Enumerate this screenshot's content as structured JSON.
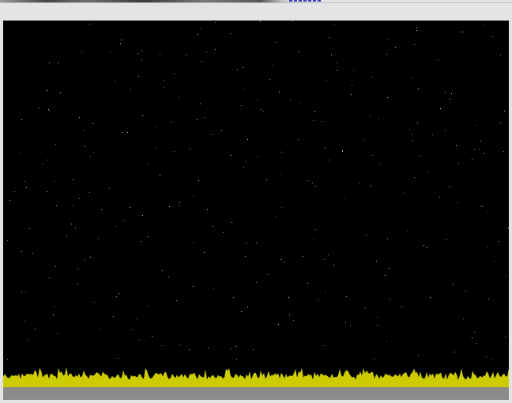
{
  "screen": {
    "background_color": "#e4e4e4",
    "top_strip": "browser-toolbar-strip"
  },
  "game": {
    "scene": "starfield",
    "sky_color": "#000000",
    "star_color": "#e6e6e6",
    "grass_color": "#cccc00",
    "ground_color": "#8a8a8a"
  }
}
